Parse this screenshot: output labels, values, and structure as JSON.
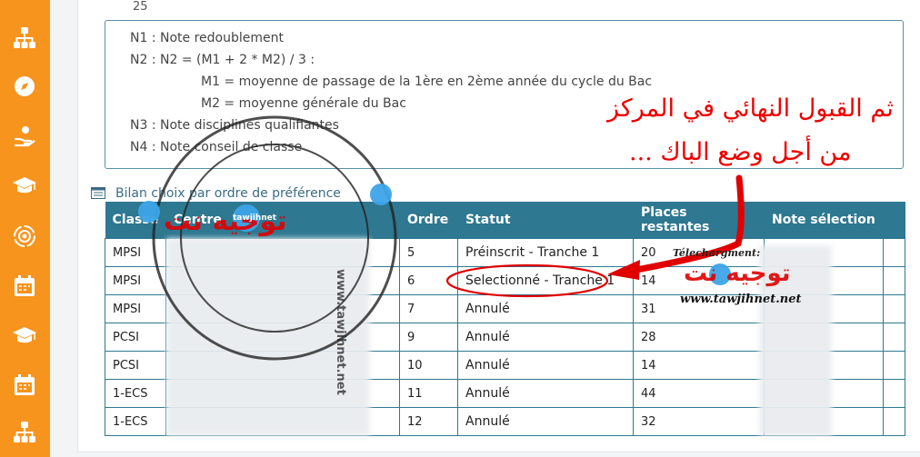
{
  "sidebar": {
    "items": [
      {
        "icon": "sitemap-icon"
      },
      {
        "icon": "compass-icon"
      },
      {
        "icon": "hand-coin-icon"
      },
      {
        "icon": "graduation-cap-icon"
      },
      {
        "icon": "settings-cycle-icon"
      },
      {
        "icon": "calendar-icon"
      },
      {
        "icon": "graduation-cap-icon"
      },
      {
        "icon": "calendar-icon"
      },
      {
        "icon": "sitemap-icon"
      }
    ],
    "accent": "#f7941d"
  },
  "notes": {
    "top_value": "25",
    "lines": [
      "N1 : Note redoublement",
      "N2 : N2 = (M1 + 2 * M2) / 3 :",
      "M1 = moyenne de passage de la 1ère en 2ème année du cycle du Bac",
      "M2 = moyenne générale du Bac",
      "N3 : Note disciplines qualifiantes",
      "N4 : Note conseil de classe"
    ]
  },
  "bilan": {
    "title": "Bilan choix par ordre de préférence",
    "headers": [
      "Classe",
      "Centre",
      "Ordre",
      "Statut",
      "Places restantes",
      "Note sélection"
    ],
    "rows": [
      {
        "classe": "MPSI",
        "ordre": "5",
        "statut": "Préinscrit - Tranche 1",
        "places": "20"
      },
      {
        "classe": "MPSI",
        "ordre": "6",
        "statut": "Selectionné - Tranche 1",
        "places": "14"
      },
      {
        "classe": "MPSI",
        "ordre": "7",
        "statut": "Annulé",
        "places": "31"
      },
      {
        "classe": "PCSI",
        "ordre": "9",
        "statut": "Annulé",
        "places": "28"
      },
      {
        "classe": "PCSI",
        "ordre": "10",
        "statut": "Annulé",
        "places": "14"
      },
      {
        "classe": "1-ECS",
        "ordre": "11",
        "statut": "Annulé",
        "places": "44"
      },
      {
        "classe": "1-ECS",
        "ordre": "12",
        "statut": "Annulé",
        "places": "32"
      }
    ],
    "header_color": "#2e7891"
  },
  "annotation": {
    "line1": "ثم القبول النهائي في المركز",
    "line2": "من أجل وضع الباك ...",
    "color": "#e00000"
  },
  "watermark": {
    "brand_ar": "توجيه نت",
    "logo_text": "tawjihnet",
    "ring_text": "www.tawjihnet.net",
    "download_label": "Télechargment:",
    "site": "www.tawjihnet.net"
  }
}
